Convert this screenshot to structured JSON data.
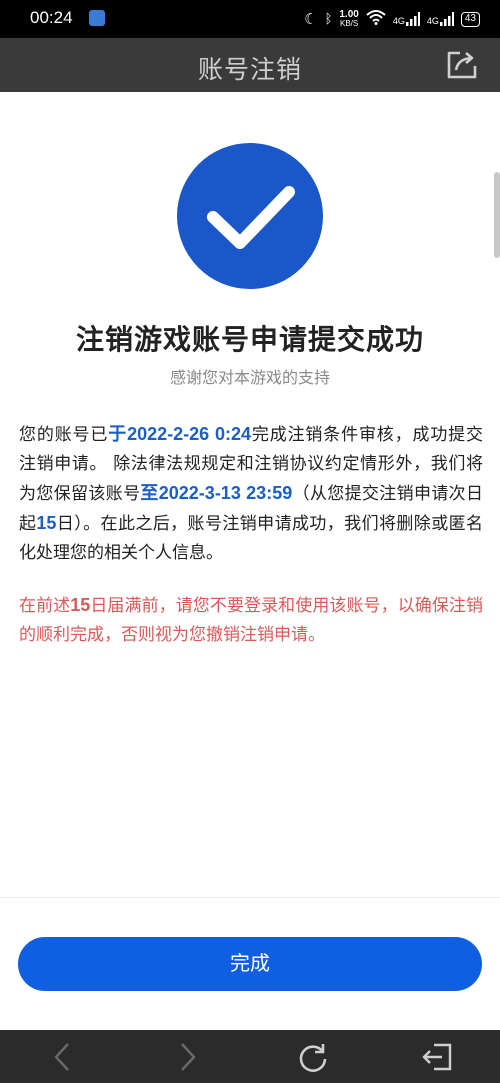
{
  "status_bar": {
    "time": "00:24",
    "speed_value": "1.00",
    "speed_unit": "KB/S",
    "signal_1": "4G",
    "signal_2": "4G",
    "battery": "43"
  },
  "header": {
    "title": "账号注销",
    "share_icon": "share-icon"
  },
  "result": {
    "icon": "checkmark-icon",
    "accent_color": "#1a57c9",
    "title": "注销游戏账号申请提交成功",
    "subtitle": "感谢您对本游戏的支持"
  },
  "notice": {
    "p1_a": "您的账号已",
    "p1_b": "于2022-2-26 0:24",
    "p1_c": "完成注销条件审核，成功提交注销申请。 除法律法规规定和注销协议约定情形外，我们将为您保留该账号",
    "p1_d": "至2022-3-13 23:59",
    "p1_e": "（从您提交注销申请次日起",
    "p1_f": "15",
    "p1_g": "日）。在此之后，账号注销申请成功，我们将删除或匿名化处理您的相关个人信息。",
    "highlight_color": "#1a5ec8"
  },
  "warning": {
    "a": "在前述",
    "b": "15",
    "c": "日届满前，请您不要登录和使用该账号，以确保注销的顺利完成，否则视为您撤销注销申请。",
    "color": "#d95a5a"
  },
  "footer": {
    "done_label": "完成",
    "button_color": "#0f5fe0"
  },
  "nav": {
    "back_icon": "back-arrow-icon",
    "forward_icon": "forward-arrow-icon",
    "refresh_icon": "refresh-icon",
    "exit_icon": "exit-icon"
  }
}
